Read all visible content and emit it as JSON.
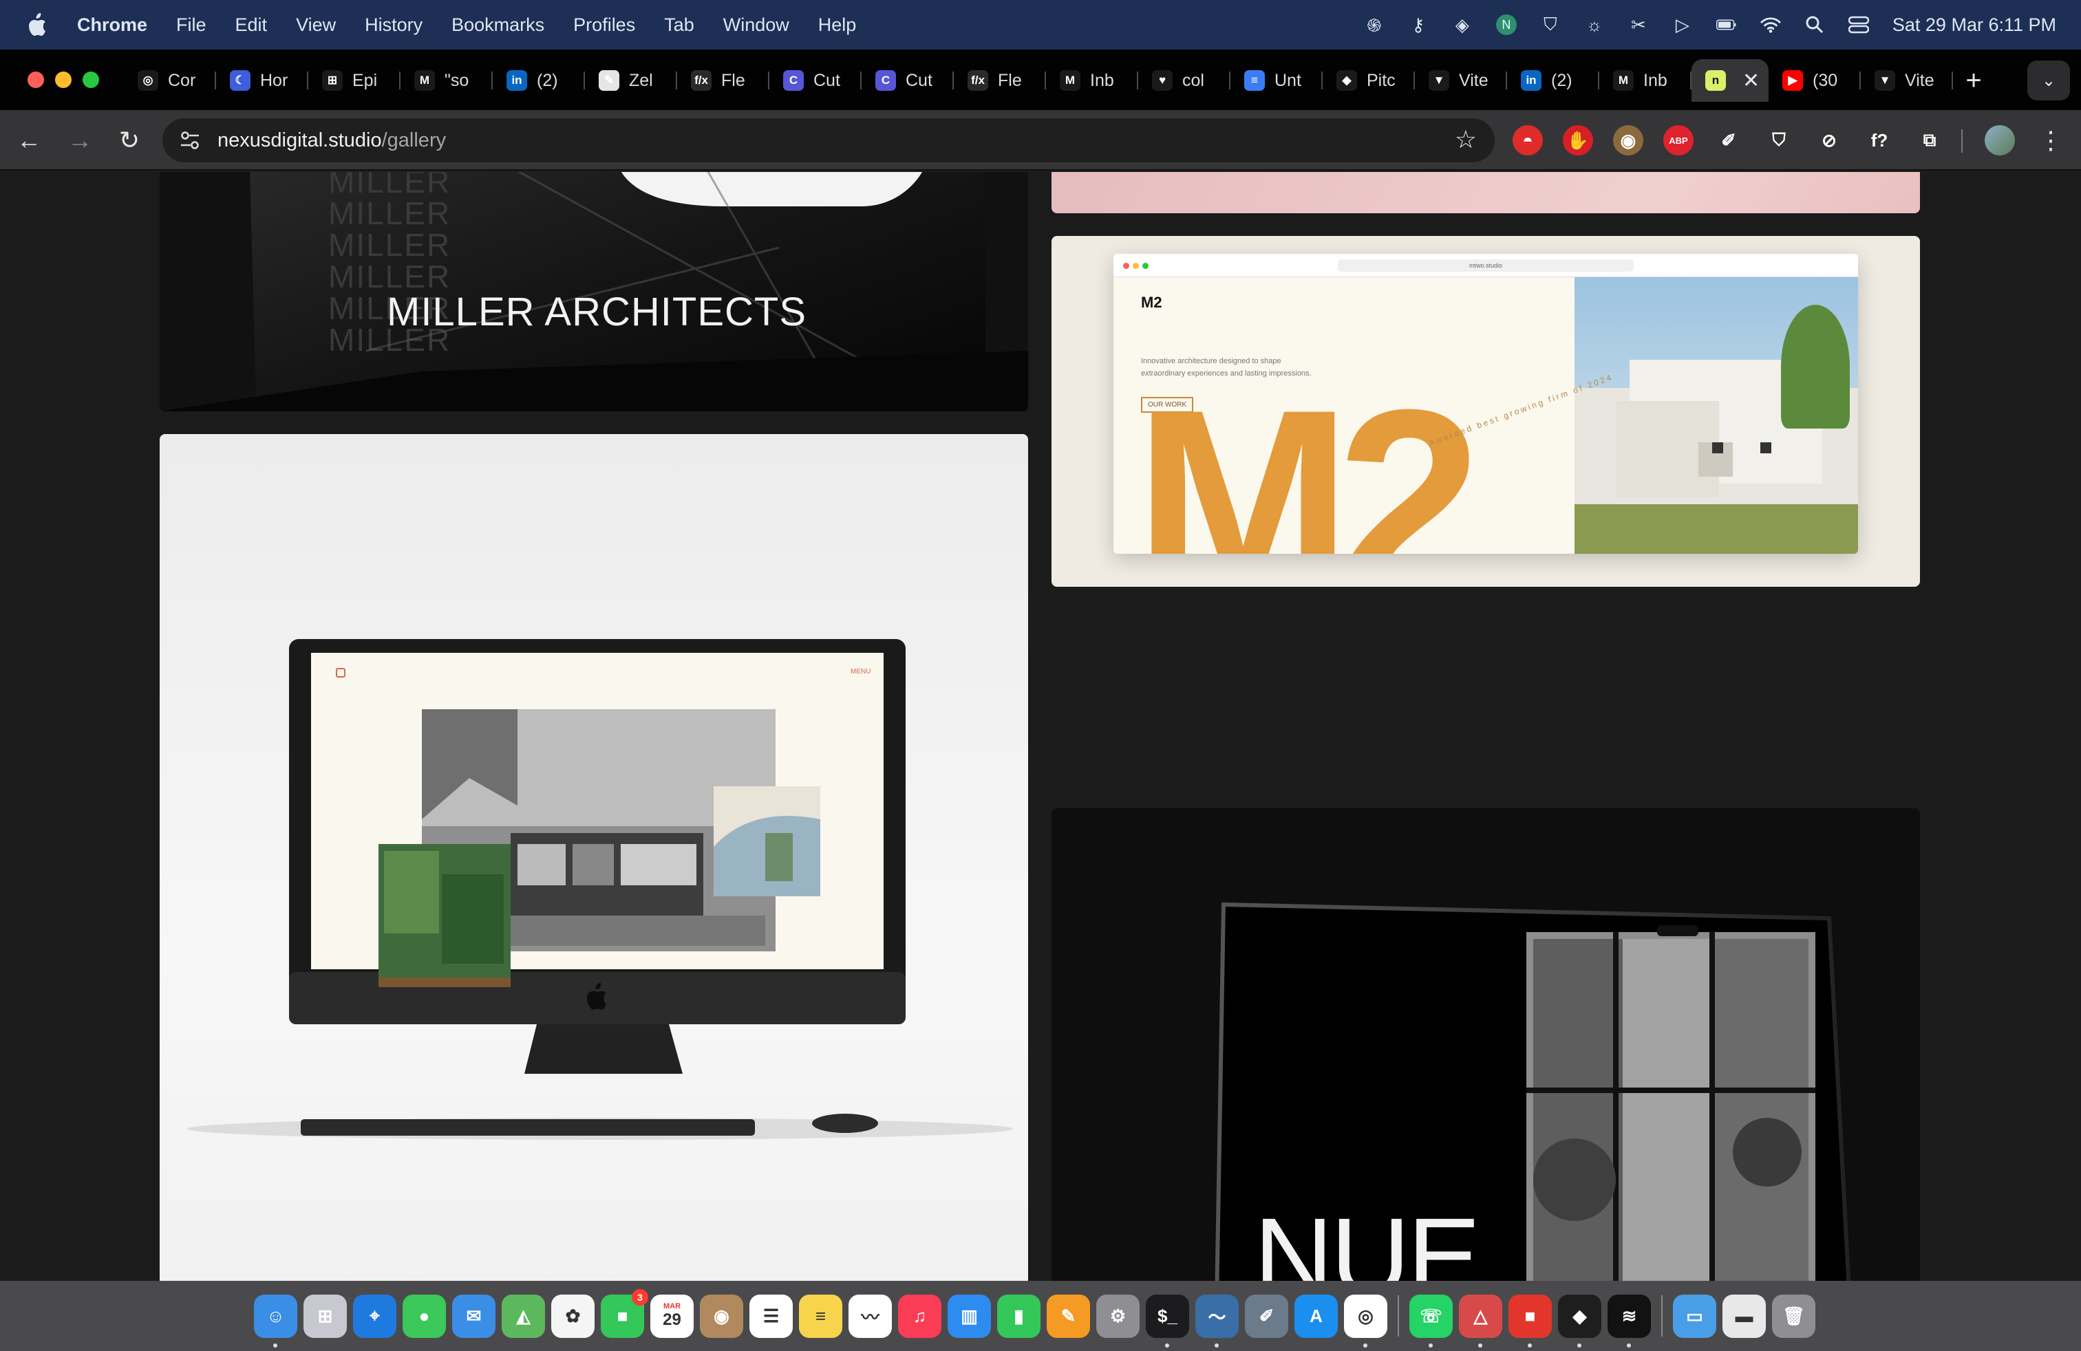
{
  "menubar": {
    "app_name": "Chrome",
    "items": [
      "File",
      "Edit",
      "View",
      "History",
      "Bookmarks",
      "Profiles",
      "Tab",
      "Window",
      "Help"
    ],
    "clock": "Sat 29 Mar  6:11 PM",
    "status_icons": [
      "drafts-icon",
      "key-icon",
      "screen-icon",
      "n-icon",
      "vpn-icon",
      "brightness-icon",
      "scissors-icon",
      "play-icon",
      "battery-icon",
      "wifi-icon",
      "search-icon",
      "control-center-icon"
    ]
  },
  "tabs": [
    {
      "title": "Cor",
      "icon": "openai-icon",
      "color": "#1a1a1a",
      "glyph": "◎"
    },
    {
      "title": "Hor",
      "icon": "horizon-icon",
      "color": "#3c5ddc",
      "glyph": "☾"
    },
    {
      "title": "Epi",
      "icon": "epic-icon",
      "color": "#1a1a1a",
      "glyph": "⊞"
    },
    {
      "title": "\"so",
      "icon": "gmail-icon",
      "color": "#1a1a1a",
      "glyph": "M"
    },
    {
      "title": "(2)",
      "icon": "linkedin-icon",
      "color": "#0a66c2",
      "glyph": "in"
    },
    {
      "title": "Zel",
      "icon": "pen-icon",
      "color": "#e6e6e6",
      "glyph": "✎"
    },
    {
      "title": "Fle",
      "icon": "fx-icon",
      "color": "#2a2a2a",
      "glyph": "f/x"
    },
    {
      "title": "Cut",
      "icon": "cut-icon",
      "color": "#5856d6",
      "glyph": "C"
    },
    {
      "title": "Cut",
      "icon": "cut-icon",
      "color": "#5856d6",
      "glyph": "C"
    },
    {
      "title": "Fle",
      "icon": "fx-icon",
      "color": "#2a2a2a",
      "glyph": "f/x"
    },
    {
      "title": "Inb",
      "icon": "gmail-icon",
      "color": "#1a1a1a",
      "glyph": "M"
    },
    {
      "title": "col",
      "icon": "heart-icon",
      "color": "#1a1a1a",
      "glyph": "♥"
    },
    {
      "title": "Unt",
      "icon": "docs-icon",
      "color": "#3b7cf4",
      "glyph": "≡"
    },
    {
      "title": "Pitc",
      "icon": "figma-icon",
      "color": "#1a1a1a",
      "glyph": "◆"
    },
    {
      "title": "Vite",
      "icon": "vite-icon",
      "color": "#1a1a1a",
      "glyph": "▼"
    },
    {
      "title": "(2)",
      "icon": "linkedin-icon",
      "color": "#0a66c2",
      "glyph": "in"
    },
    {
      "title": "Inb",
      "icon": "gmail-icon",
      "color": "#1a1a1a",
      "glyph": "M"
    },
    {
      "title": "",
      "icon": "nexus-icon",
      "color": "#d8f06a",
      "glyph": "n",
      "active": true
    },
    {
      "title": "(30",
      "icon": "youtube-icon",
      "color": "#ff0000",
      "glyph": "▶"
    },
    {
      "title": "Vite",
      "icon": "vite-icon",
      "color": "#1a1a1a",
      "glyph": "▼"
    }
  ],
  "toolbar": {
    "url_host": "nexusdigital.studio",
    "url_path": "/gallery",
    "extensions": [
      {
        "name": "pokeball-icon",
        "color": "#e02b2b",
        "glyph": "◓"
      },
      {
        "name": "hand-icon",
        "color": "#d81f26",
        "glyph": "✋"
      },
      {
        "name": "owl-icon",
        "color": "#8b6a3e",
        "glyph": "◉"
      },
      {
        "name": "adblock-icon",
        "color": "#e0212e",
        "glyph": "ABP"
      },
      {
        "name": "eyedropper-icon",
        "color": "#353537",
        "glyph": "✐"
      },
      {
        "name": "shield-icon",
        "color": "#353537",
        "glyph": "⛉"
      },
      {
        "name": "compass-icon",
        "color": "#353537",
        "glyph": "⊘"
      },
      {
        "name": "formula-icon",
        "color": "#353537",
        "glyph": "f?"
      },
      {
        "name": "puzzle-icon",
        "color": "#353537",
        "glyph": "⧉"
      }
    ]
  },
  "gallery": {
    "miller": {
      "title": "MILLER ARCHITECTS",
      "bg_word": "MILLER"
    },
    "m2": {
      "domain": "mtwo.studio",
      "logo": "M2",
      "tagline_1": "Innovative architecture designed to shape",
      "tagline_2": "extraordinary experiences and lasting impressions.",
      "cta": "OUR WORK",
      "big_text": "M2",
      "arc_text": "Awarded best growing firm of 2024",
      "accent": "#e39b3c"
    },
    "imac": {
      "menu_label": "MENU"
    },
    "nue": {
      "title": "NUE."
    }
  },
  "dock": [
    {
      "name": "finder-icon",
      "color": "#3a8ee6",
      "glyph": "☺",
      "running": true
    },
    {
      "name": "launchpad-icon",
      "color": "#c8c8d0",
      "glyph": "⊞"
    },
    {
      "name": "safari-icon",
      "color": "#1f7ae0",
      "glyph": "⌖"
    },
    {
      "name": "messages-icon",
      "color": "#3cc85a",
      "glyph": "●"
    },
    {
      "name": "mail-icon",
      "color": "#3a8ee6",
      "glyph": "✉"
    },
    {
      "name": "maps-icon",
      "color": "#5cb85c",
      "glyph": "◭"
    },
    {
      "name": "photos-icon",
      "color": "#f5f5f5",
      "glyph": "✿"
    },
    {
      "name": "facetime-icon",
      "color": "#34c759",
      "glyph": "■",
      "badge": "3"
    },
    {
      "name": "calendar-icon",
      "color": "#ffffff",
      "glyph": "29",
      "sub": "MAR"
    },
    {
      "name": "contacts-icon",
      "color": "#b08a5e",
      "glyph": "◉"
    },
    {
      "name": "reminders-icon",
      "color": "#ffffff",
      "glyph": "☰"
    },
    {
      "name": "notes-icon",
      "color": "#f7d44c",
      "glyph": "≡"
    },
    {
      "name": "freeform-icon",
      "color": "#ffffff",
      "glyph": "〰"
    },
    {
      "name": "music-icon",
      "color": "#fa3c55",
      "glyph": "♫"
    },
    {
      "name": "keynote-icon",
      "color": "#2d8cf0",
      "glyph": "▥"
    },
    {
      "name": "numbers-icon",
      "color": "#34c759",
      "glyph": "▮"
    },
    {
      "name": "pages-icon",
      "color": "#f59a23",
      "glyph": "✎"
    },
    {
      "name": "settings-icon",
      "color": "#8e8e93",
      "glyph": "⚙"
    },
    {
      "name": "terminal-icon",
      "color": "#1c1c1e",
      "glyph": "$_",
      "running": true
    },
    {
      "name": "sequel-icon",
      "color": "#3a6ea8",
      "glyph": "〜",
      "running": true
    },
    {
      "name": "editor-icon",
      "color": "#6b7b8c",
      "glyph": "✐"
    },
    {
      "name": "app-store-icon",
      "color": "#1b8ff0",
      "glyph": "A"
    },
    {
      "name": "chrome-icon",
      "color": "#ffffff",
      "glyph": "◎",
      "running": true
    },
    {
      "name": "whatsapp-icon",
      "color": "#25d366",
      "glyph": "☏",
      "running": true
    },
    {
      "name": "affinity-icon",
      "color": "#d84a4a",
      "glyph": "△",
      "running": true
    },
    {
      "name": "clip-icon",
      "color": "#e2362c",
      "glyph": "■",
      "running": true
    },
    {
      "name": "figma-icon",
      "color": "#1e1e1e",
      "glyph": "◆",
      "running": true
    },
    {
      "name": "spotify-icon",
      "color": "#121212",
      "glyph": "≋",
      "running": true
    },
    {
      "name": "downloads-icon",
      "color": "#4a9ee8",
      "glyph": "▭"
    },
    {
      "name": "window-icon",
      "color": "#e8e8e8",
      "glyph": "▬"
    },
    {
      "name": "trash-icon",
      "color": "#8e8e93",
      "glyph": "🗑"
    }
  ]
}
